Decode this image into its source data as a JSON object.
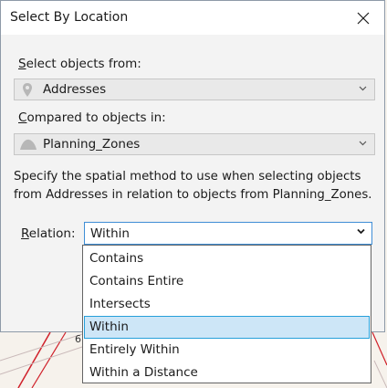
{
  "dialog": {
    "title": "Select By Location",
    "close_glyph": "×"
  },
  "select_from": {
    "label_underlined": "S",
    "label_rest": "elect objects from:",
    "value": "Addresses",
    "icon": "map-pin-icon"
  },
  "compared_to": {
    "label_underlined": "C",
    "label_rest": "ompared to objects in:",
    "value": "Planning_Zones",
    "icon": "polygon-layer-icon"
  },
  "description": "Specify the spatial method to use when selecting objects from Addresses in relation to objects from Planning_Zones.",
  "relation": {
    "label_underlined": "R",
    "label_rest": "elation:",
    "value": "Within",
    "options": [
      "Contains",
      "Contains Entire",
      "Intersects",
      "Within",
      "Entirely Within",
      "Within a Distance"
    ],
    "selected_index": 3
  },
  "map_fragment": {
    "visible_text": "6"
  },
  "colors": {
    "accent": "#3f8ed6",
    "selection_bg": "#cde6f7",
    "selection_border": "#26a0da",
    "map_line": "#d0202a"
  }
}
